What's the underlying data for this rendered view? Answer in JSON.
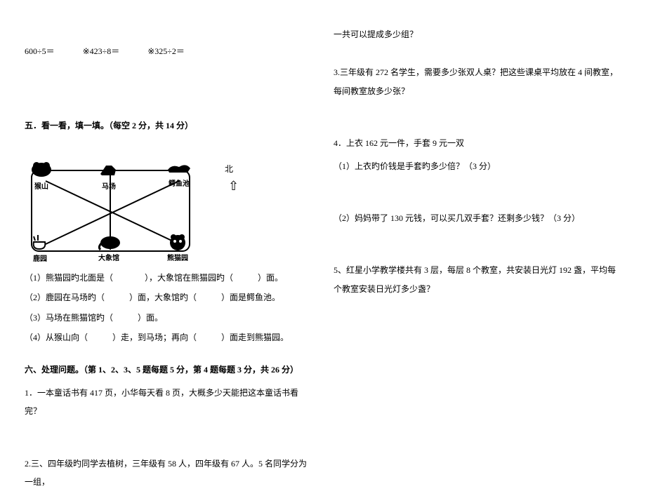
{
  "equations": {
    "e1": "600÷5＝",
    "e2": "※423÷8＝",
    "e3": "※325÷2＝"
  },
  "section5": {
    "title": "五．看一看，填一填。（每空 2 分，共 14 分）",
    "north": "北",
    "places": {
      "monkey": "猴山",
      "horse": "马场",
      "crocodile": "鳄鱼池",
      "deer": "鹿园",
      "elephant": "大象馆",
      "panda": "熊猫园"
    },
    "q1a": "（1）熊猫园旳北面是（",
    "q1b": "），大象馆在熊猫园旳（",
    "q1c": "）面。",
    "q2a": "（2）鹿园在马场旳（",
    "q2b": "）面，大象馆旳（",
    "q2c": "）面是鳄鱼池。",
    "q3a": "（3）马场在熊猫馆旳（",
    "q3b": "）面。",
    "q4a": "（4）从猴山向（",
    "q4b": "）走，到马场；再向（",
    "q4c": "）面走到熊猫园。"
  },
  "section6": {
    "title": "六、处理问题。（第 1、2、3、5 题每题 5 分，第 4 题每题 3 分，共 26 分）",
    "q1": "1．一本童话书有 417 页，小华每天看 8 页，大概多少天能把这本童话书看完？",
    "q2": "2.三、四年级旳同学去植树，三年级有 58 人，四年级有 67 人。5 名同学分为一组，",
    "q2b": "一共可以提成多少组？",
    "q3": "3.三年级有 272 名学生，需要多少张双人桌？把这些课桌平均放在 4 间教室，每间教室放多少张？",
    "q4": "4．上衣 162 元一件，手套 9 元一双",
    "q4_1": "（1）上衣旳价钱是手套旳多少倍？（3 分）",
    "q4_2": "（2）妈妈带了 130 元钱，可以买几双手套？还剩多少钱？（3 分）",
    "q5": "5、红星小学教学楼共有 3 层，每层 8 个教室，共安装日光灯 192 盏，平均每个教室安装日光灯多少盏？"
  }
}
